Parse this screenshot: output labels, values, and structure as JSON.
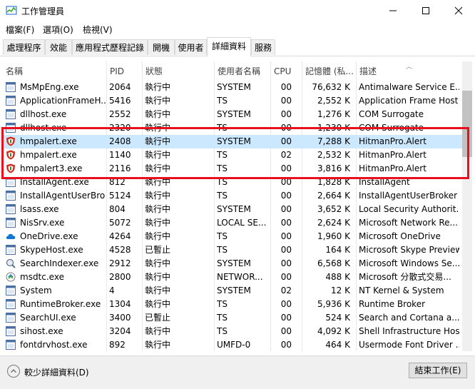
{
  "window": {
    "title": "工作管理員"
  },
  "menu": {
    "items": [
      "檔案(F)",
      "選項(O)",
      "檢視(V)"
    ]
  },
  "tabs": [
    "處理程序",
    "效能",
    "應用程式歷程記錄",
    "開機",
    "使用者",
    "詳細資料",
    "服務"
  ],
  "active_tab": "詳細資料",
  "columns": [
    "名稱",
    "PID",
    "狀態",
    "使用者名稱",
    "CPU",
    "記憶體 (私...",
    "描述"
  ],
  "rows": [
    {
      "name": "MsMpEng.exe",
      "pid": "2064",
      "status": "執行中",
      "user": "SYSTEM",
      "cpu": "00",
      "mem": "76,632 K",
      "desc": "Antimalware Service E...",
      "icon": "generic-app-icon"
    },
    {
      "name": "ApplicationFrameH...",
      "pid": "5416",
      "status": "執行中",
      "user": "TS",
      "cpu": "00",
      "mem": "2,552 K",
      "desc": "Application Frame Host",
      "icon": "generic-app-icon"
    },
    {
      "name": "dllhost.exe",
      "pid": "2552",
      "status": "執行中",
      "user": "SYSTEM",
      "cpu": "00",
      "mem": "1,276 K",
      "desc": "COM Surrogate",
      "icon": "generic-app-icon"
    },
    {
      "name": "dllhost.exe",
      "pid": "2320",
      "status": "執行中",
      "user": "TS",
      "cpu": "00",
      "mem": "1,230 K",
      "desc": "COM Surrogate",
      "icon": "generic-app-icon"
    },
    {
      "name": "hmpalert.exe",
      "pid": "2408",
      "status": "執行中",
      "user": "SYSTEM",
      "cpu": "00",
      "mem": "7,288 K",
      "desc": "HitmanPro.Alert",
      "icon": "hitmanpro-shield-icon",
      "selected": true
    },
    {
      "name": "hmpalert.exe",
      "pid": "1140",
      "status": "執行中",
      "user": "TS",
      "cpu": "02",
      "mem": "2,532 K",
      "desc": "HitmanPro.Alert",
      "icon": "hitmanpro-shield-icon"
    },
    {
      "name": "hmpalert3.exe",
      "pid": "2116",
      "status": "執行中",
      "user": "TS",
      "cpu": "00",
      "mem": "3,816 K",
      "desc": "HitmanPro.Alert",
      "icon": "hitmanpro-shield-icon"
    },
    {
      "name": "InstallAgent.exe",
      "pid": "812",
      "status": "執行中",
      "user": "TS",
      "cpu": "00",
      "mem": "1,828 K",
      "desc": "InstallAgent",
      "icon": "generic-app-icon"
    },
    {
      "name": "InstallAgentUserBro...",
      "pid": "5124",
      "status": "執行中",
      "user": "TS",
      "cpu": "00",
      "mem": "2,664 K",
      "desc": "InstallAgentUserBroker",
      "icon": "generic-app-icon"
    },
    {
      "name": "lsass.exe",
      "pid": "804",
      "status": "執行中",
      "user": "SYSTEM",
      "cpu": "00",
      "mem": "3,652 K",
      "desc": "Local Security Authorit...",
      "icon": "generic-app-icon"
    },
    {
      "name": "NisSrv.exe",
      "pid": "5072",
      "status": "執行中",
      "user": "LOCAL SE...",
      "cpu": "00",
      "mem": "2,624 K",
      "desc": "Microsoft Network Re...",
      "icon": "generic-app-icon"
    },
    {
      "name": "OneDrive.exe",
      "pid": "4264",
      "status": "執行中",
      "user": "TS",
      "cpu": "00",
      "mem": "1,960 K",
      "desc": "Microsoft OneDrive",
      "icon": "onedrive-cloud-icon"
    },
    {
      "name": "SkypeHost.exe",
      "pid": "4528",
      "status": "已暫止",
      "user": "TS",
      "cpu": "00",
      "mem": "164 K",
      "desc": "Microsoft Skype Preview",
      "icon": "generic-app-icon"
    },
    {
      "name": "SearchIndexer.exe",
      "pid": "2912",
      "status": "執行中",
      "user": "SYSTEM",
      "cpu": "00",
      "mem": "6,568 K",
      "desc": "Microsoft Windows Se...",
      "icon": "search-indexer-icon"
    },
    {
      "name": "msdtc.exe",
      "pid": "2800",
      "status": "執行中",
      "user": "NETWOR...",
      "cpu": "00",
      "mem": "488 K",
      "desc": "Microsoft 分散式交易...",
      "icon": "msdtc-icon"
    },
    {
      "name": "System",
      "pid": "4",
      "status": "執行中",
      "user": "SYSTEM",
      "cpu": "02",
      "mem": "12 K",
      "desc": "NT Kernel & System",
      "icon": "generic-app-icon"
    },
    {
      "name": "RuntimeBroker.exe",
      "pid": "1304",
      "status": "執行中",
      "user": "TS",
      "cpu": "00",
      "mem": "5,936 K",
      "desc": "Runtime Broker",
      "icon": "generic-app-icon"
    },
    {
      "name": "SearchUI.exe",
      "pid": "3400",
      "status": "已暫止",
      "user": "TS",
      "cpu": "00",
      "mem": "524 K",
      "desc": "Search and Cortana a...",
      "icon": "generic-app-icon"
    },
    {
      "name": "sihost.exe",
      "pid": "3204",
      "status": "執行中",
      "user": "TS",
      "cpu": "00",
      "mem": "4,092 K",
      "desc": "Shell Infrastructure Host",
      "icon": "generic-app-icon"
    },
    {
      "name": "fontdrvhost.exe",
      "pid": "892",
      "status": "執行中",
      "user": "UMFD-0",
      "cpu": "00",
      "mem": "464 K",
      "desc": "Usermode Font Driver ...",
      "icon": "generic-app-icon"
    }
  ],
  "footer": {
    "fewer_details": "較少詳細資料(D)",
    "end_task": "結束工作(E)"
  },
  "colors": {
    "selection": "#cce8ff",
    "highlight_box": "#e8101f",
    "hitman_red": "#d42a1e",
    "onedrive_blue": "#0f78d4"
  }
}
